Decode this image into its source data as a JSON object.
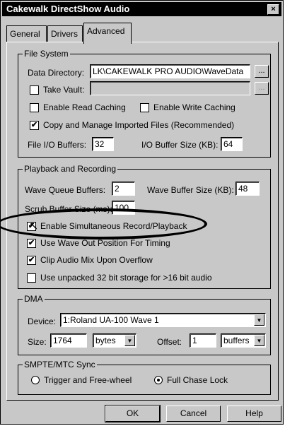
{
  "window": {
    "title": "Cakewalk DirectShow Audio",
    "close_glyph": "×"
  },
  "tabs": [
    {
      "label": "General"
    },
    {
      "label": "Drivers"
    },
    {
      "label": "Advanced"
    }
  ],
  "file_system": {
    "group_label": "File System",
    "data_directory_label": "Data Directory:",
    "data_directory_value": "LK\\CAKEWALK PRO AUDIO\\WaveData",
    "browse_label": "...",
    "take_vault_label": "Take Vault:",
    "take_vault_checked": false,
    "take_vault_value": "",
    "take_vault_browse_label": "...",
    "enable_read_caching_label": "Enable Read Caching",
    "enable_read_caching_checked": false,
    "enable_write_caching_label": "Enable Write Caching",
    "enable_write_caching_checked": false,
    "copy_manage_label": "Copy and Manage Imported Files (Recommended)",
    "copy_manage_checked": true,
    "file_io_buffers_label": "File I/O Buffers:",
    "file_io_buffers_value": "32",
    "io_buffer_size_label": "I/O Buffer Size (KB):",
    "io_buffer_size_value": "64"
  },
  "playback": {
    "group_label": "Playback and Recording",
    "wave_queue_label": "Wave Queue Buffers:",
    "wave_queue_value": "2",
    "wave_buffer_size_label": "Wave Buffer Size (KB):",
    "wave_buffer_size_value": "48",
    "scrub_buffer_label": "Scrub Buffer Size (ms):",
    "scrub_buffer_value": "100",
    "simultaneous_label": "Enable Simultaneous Record/Playback",
    "simultaneous_checked": true,
    "wave_out_label": "Use Wave Out Position For Timing",
    "wave_out_checked": true,
    "clip_audio_label": "Clip Audio Mix Upon Overflow",
    "clip_audio_checked": true,
    "unpacked_label": "Use unpacked 32 bit storage for >16 bit audio",
    "unpacked_checked": false
  },
  "dma": {
    "group_label": "DMA",
    "device_label": "Device:",
    "device_value": "1:Roland UA-100 Wave 1",
    "size_label": "Size:",
    "size_value": "1764",
    "size_unit": "bytes",
    "offset_label": "Offset:",
    "offset_value": "1",
    "offset_unit": "buffers",
    "dropdown_glyph": "▼"
  },
  "smpte": {
    "group_label": "SMPTE/MTC Sync",
    "trigger_label": "Trigger and Free-wheel",
    "trigger_selected": false,
    "chase_label": "Full Chase Lock",
    "chase_selected": true
  },
  "buttons": {
    "ok": "OK",
    "cancel": "Cancel",
    "help": "Help"
  },
  "check_glyph": "✔",
  "cursor_glyph": "↖"
}
